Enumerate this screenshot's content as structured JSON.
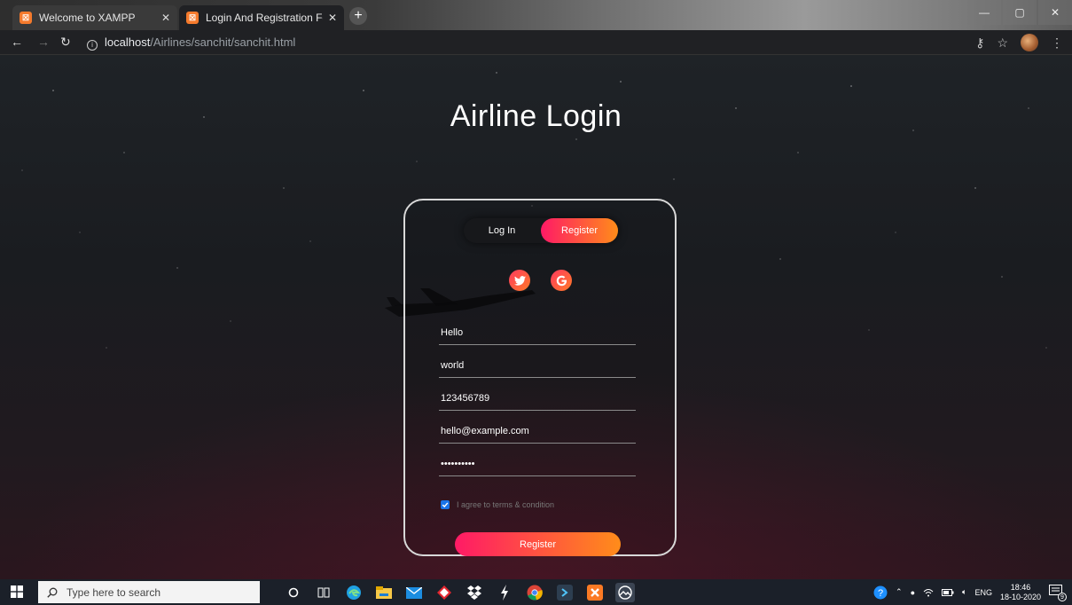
{
  "browser": {
    "tabs": [
      {
        "title": "Welcome to XAMPP",
        "active": false
      },
      {
        "title": "Login And Registration Form - A",
        "active": true
      }
    ],
    "address": {
      "host": "localhost",
      "path": "/Airlines/sanchit/sanchit.html"
    }
  },
  "page": {
    "title": "Airline Login",
    "toggle": {
      "login_label": "Log In",
      "register_label": "Register",
      "selected": "Register"
    },
    "social": [
      {
        "icon": "twitter-icon"
      },
      {
        "icon": "google-icon"
      }
    ],
    "form": {
      "fields": [
        {
          "name": "first-name",
          "value": "Hello"
        },
        {
          "name": "last-name",
          "value": "world"
        },
        {
          "name": "phone",
          "value": "123456789"
        },
        {
          "name": "email",
          "value": "hello@example.com"
        },
        {
          "name": "password",
          "value": "••••••••••"
        }
      ],
      "agree_label": "I agree to terms & condition",
      "agree_checked": true,
      "submit_label": "Register"
    }
  },
  "taskbar": {
    "search_placeholder": "Type here to search",
    "language": "ENG",
    "time": "18:46",
    "date": "18-10-2020",
    "notification_count": "9"
  },
  "colors": {
    "accent_start": "#ff1a66",
    "accent_end": "#ff8c1a",
    "checkbox": "#1a73e8"
  }
}
